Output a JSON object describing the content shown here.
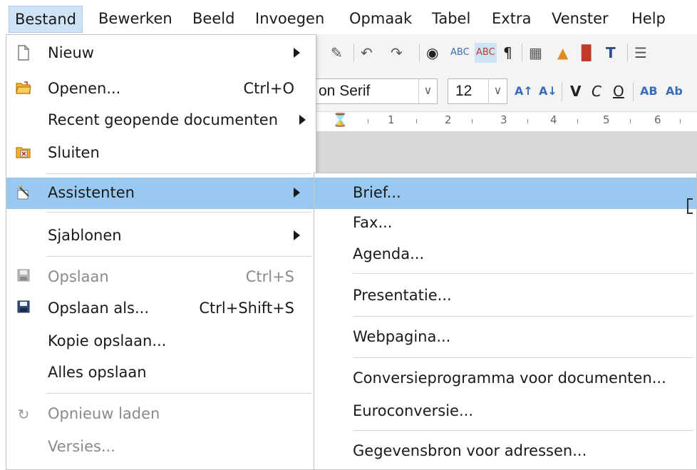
{
  "menubar": {
    "items": [
      "Bestand",
      "Bewerken",
      "Beeld",
      "Invoegen",
      "Opmaak",
      "Tabel",
      "Extra",
      "Venster",
      "Help"
    ]
  },
  "toolbar": {
    "font_name": "on Serif",
    "font_size": "12",
    "ruler_numbers": [
      "1",
      "2",
      "3",
      "4",
      "5",
      "6"
    ]
  },
  "file_menu": {
    "items": [
      {
        "label": "Nieuw",
        "icon": "new-document-icon",
        "shortcut": "",
        "submenu": true
      },
      {
        "label": "Openen...",
        "icon": "open-folder-icon",
        "shortcut": "Ctrl+O",
        "submenu": false
      },
      {
        "label": "Recent geopende documenten",
        "icon": "",
        "shortcut": "",
        "submenu": true
      },
      {
        "label": "Sluiten",
        "icon": "close-document-icon",
        "shortcut": "",
        "submenu": false
      },
      {
        "label": "Assistenten",
        "icon": "wizard-wand-icon",
        "shortcut": "",
        "submenu": true
      },
      {
        "label": "Sjablonen",
        "icon": "",
        "shortcut": "",
        "submenu": true
      },
      {
        "label": "Opslaan",
        "icon": "save-icon",
        "shortcut": "Ctrl+S",
        "submenu": false
      },
      {
        "label": "Opslaan als...",
        "icon": "save-as-icon",
        "shortcut": "Ctrl+Shift+S",
        "submenu": false
      },
      {
        "label": "Kopie opslaan...",
        "icon": "",
        "shortcut": "",
        "submenu": false
      },
      {
        "label": "Alles opslaan",
        "icon": "",
        "shortcut": "",
        "submenu": false
      },
      {
        "label": "Opnieuw laden",
        "icon": "reload-icon",
        "shortcut": "",
        "submenu": false
      },
      {
        "label": "Versies...",
        "icon": "",
        "shortcut": "",
        "submenu": false
      }
    ]
  },
  "wizard_submenu": {
    "items": [
      "Brief...",
      "Fax...",
      "Agenda...",
      "Presentatie...",
      "Webpagina...",
      "Conversieprogramma voor documenten...",
      "Euroconversie...",
      "Gegevensbron voor adressen..."
    ]
  },
  "colors": {
    "highlight": "#99c9f1",
    "menubar_active": "#cfe3f7",
    "disabled_text": "#8a8a8a"
  }
}
